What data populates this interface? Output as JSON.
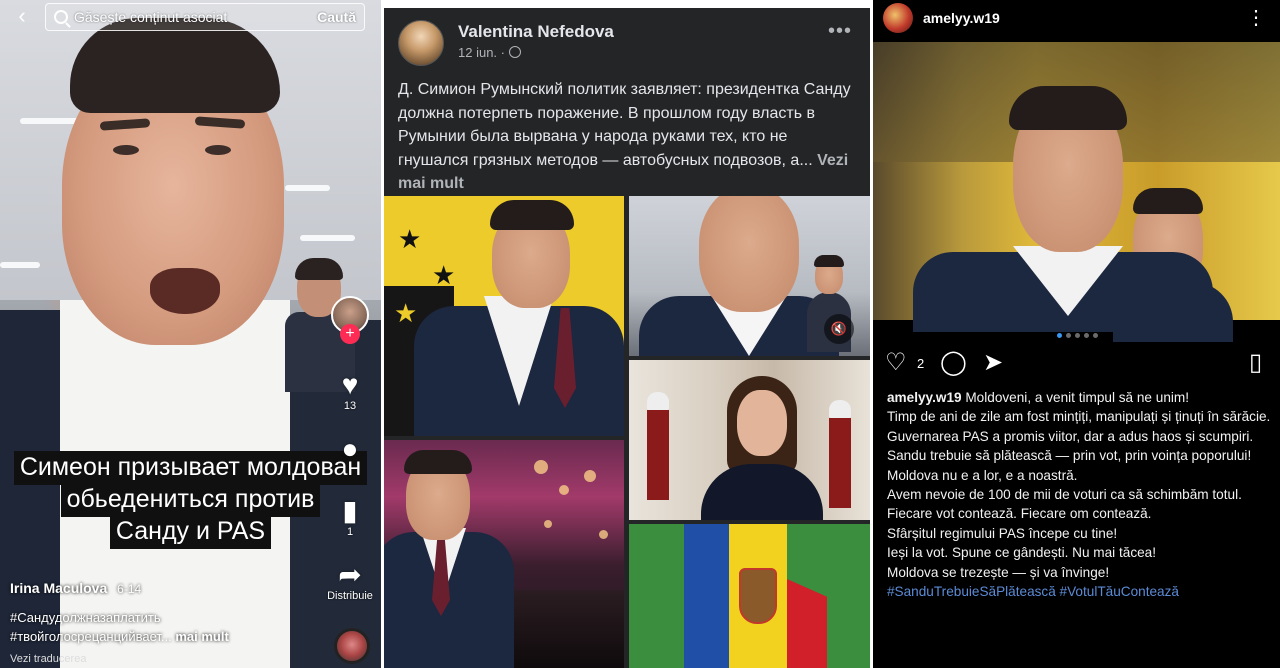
{
  "tiktok": {
    "search_placeholder": "Găsește conținut asociat",
    "search_button": "Caută",
    "caption_lines": [
      "Симеон призывает молдован",
      "обьедениться против",
      "Санду и PAS"
    ],
    "like_count": "13",
    "comment_count": "1",
    "share_label": "Distribuie",
    "author": "Irina Maculova",
    "date": "6-14",
    "hashtag_1": "#Сандудолжназаплатить",
    "hashtag_2": "#твойголосрецанцийвает...",
    "more_label": "mai mult",
    "translate_label": "Vezi traducerea",
    "accent_color": "#fe2c55"
  },
  "facebook": {
    "author": "Valentina Nefedova",
    "date": "12 iun. ·",
    "post_text": "Д. Симион Румынский политик заявляет: президентка Санду должна потерпеть поражение. В прошлом году власть в Румынии была вырвана у народа руками тех, кто не гнушался грязных методов — автобусных подвозов, а...",
    "see_more": "Vezi mai mult",
    "more_icon": "ellipsis-icon",
    "mute_icon": "speaker-mute-icon"
  },
  "instagram": {
    "username": "amelyy.w19",
    "like_count": "2",
    "caption_lines": [
      "Moldoveni, a venit timpul să ne unim!",
      "Timp de ani de zile am fost mințiți, manipulați și ținuți în sărăcie.",
      "Guvernarea PAS a promis viitor, dar a adus haos și scumpiri.",
      "Sandu trebuie să plătească — prin vot, prin voința poporului!",
      "Moldova nu e a lor, e a noastră.",
      "Avem nevoie de 100 de mii de voturi ca să schimbăm totul.",
      "Fiecare vot contează. Fiecare om contează.",
      "Sfârșitul regimului PAS începe cu tine!",
      "Ieși la vot. Spune ce gândești. Nu mai tăcea!",
      "Moldova se trezește — și va învinge!"
    ],
    "hashtags": "#SanduTrebuieSăPlătească #VotulTăuContează",
    "link_color": "#5c8bd6"
  }
}
